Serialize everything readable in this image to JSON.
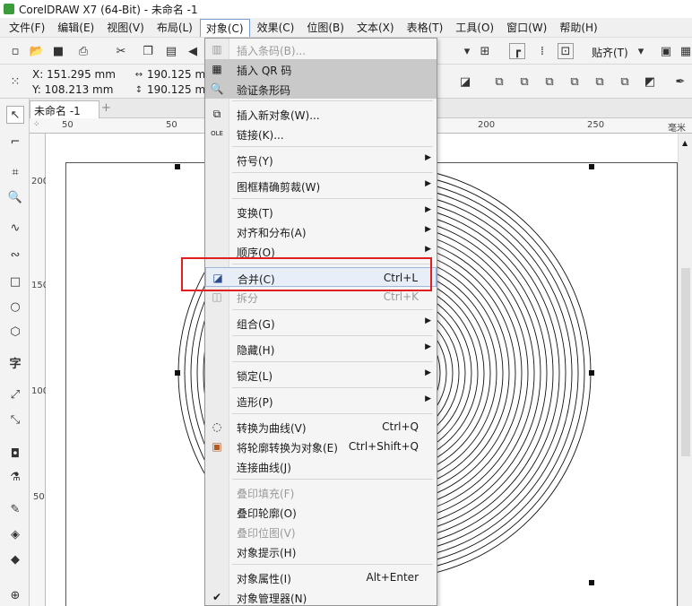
{
  "window": {
    "title": "CorelDRAW X7 (64-Bit) - 未命名 -1"
  },
  "menubar": [
    "文件(F)",
    "编辑(E)",
    "视图(V)",
    "布局(L)",
    "对象(C)",
    "效果(C)",
    "位图(B)",
    "文本(X)",
    "表格(T)",
    "工具(O)",
    "窗口(W)",
    "帮助(H)"
  ],
  "toolbar": {
    "snap_label": "贴齐(T)"
  },
  "propbar": {
    "x": "X: 151.295 mm",
    "y": "Y: 108.213 mm",
    "w": "190.125 mm",
    "h": "190.125 mm"
  },
  "doc": {
    "tab": "未命名 -1",
    "unit": "毫米"
  },
  "ruler": {
    "h": [
      "50",
      "200",
      "250"
    ],
    "v": [
      "200",
      "150",
      "100",
      "50"
    ]
  },
  "menu": {
    "items": [
      {
        "label": "插入条码(B)...",
        "disabled": true,
        "icon": "barcode-icon"
      },
      {
        "label": "插入 QR 码",
        "highlight": true,
        "icon": "qr-icon"
      },
      {
        "label": "验证条形码",
        "highlight": true,
        "icon": "magnifier-icon"
      },
      {
        "label": "插入新对象(W)...",
        "icon": "insert-object-icon"
      },
      {
        "label": "链接(K)...",
        "icon": "ole-icon"
      },
      {
        "label": "符号(Y)",
        "arrow": true
      },
      {
        "label": "图框精确剪裁(W)",
        "arrow": true
      },
      {
        "label": "变换(T)",
        "arrow": true
      },
      {
        "label": "对齐和分布(A)",
        "arrow": true
      },
      {
        "label": "顺序(O)",
        "arrow": true
      },
      {
        "label": "合并(C)",
        "shortcut": "Ctrl+L",
        "focused": true,
        "icon": "combine-icon"
      },
      {
        "label": "拆分",
        "shortcut": "Ctrl+K",
        "disabled": true,
        "icon": "break-apart-icon"
      },
      {
        "label": "组合(G)",
        "arrow": true
      },
      {
        "label": "隐藏(H)",
        "arrow": true
      },
      {
        "label": "锁定(L)",
        "arrow": true
      },
      {
        "label": "造形(P)",
        "arrow": true
      },
      {
        "label": "转换为曲线(V)",
        "shortcut": "Ctrl+Q",
        "icon": "convert-curve-icon"
      },
      {
        "label": "将轮廓转换为对象(E)",
        "shortcut": "Ctrl+Shift+Q",
        "icon": "outline-object-icon"
      },
      {
        "label": "连接曲线(J)"
      },
      {
        "label": "叠印填充(F)",
        "disabled": true
      },
      {
        "label": "叠印轮廓(O)"
      },
      {
        "label": "叠印位图(V)",
        "disabled": true
      },
      {
        "label": "对象提示(H)"
      },
      {
        "label": "对象属性(I)",
        "shortcut": "Alt+Enter"
      },
      {
        "label": "对象管理器(N)",
        "checked": true
      }
    ]
  }
}
